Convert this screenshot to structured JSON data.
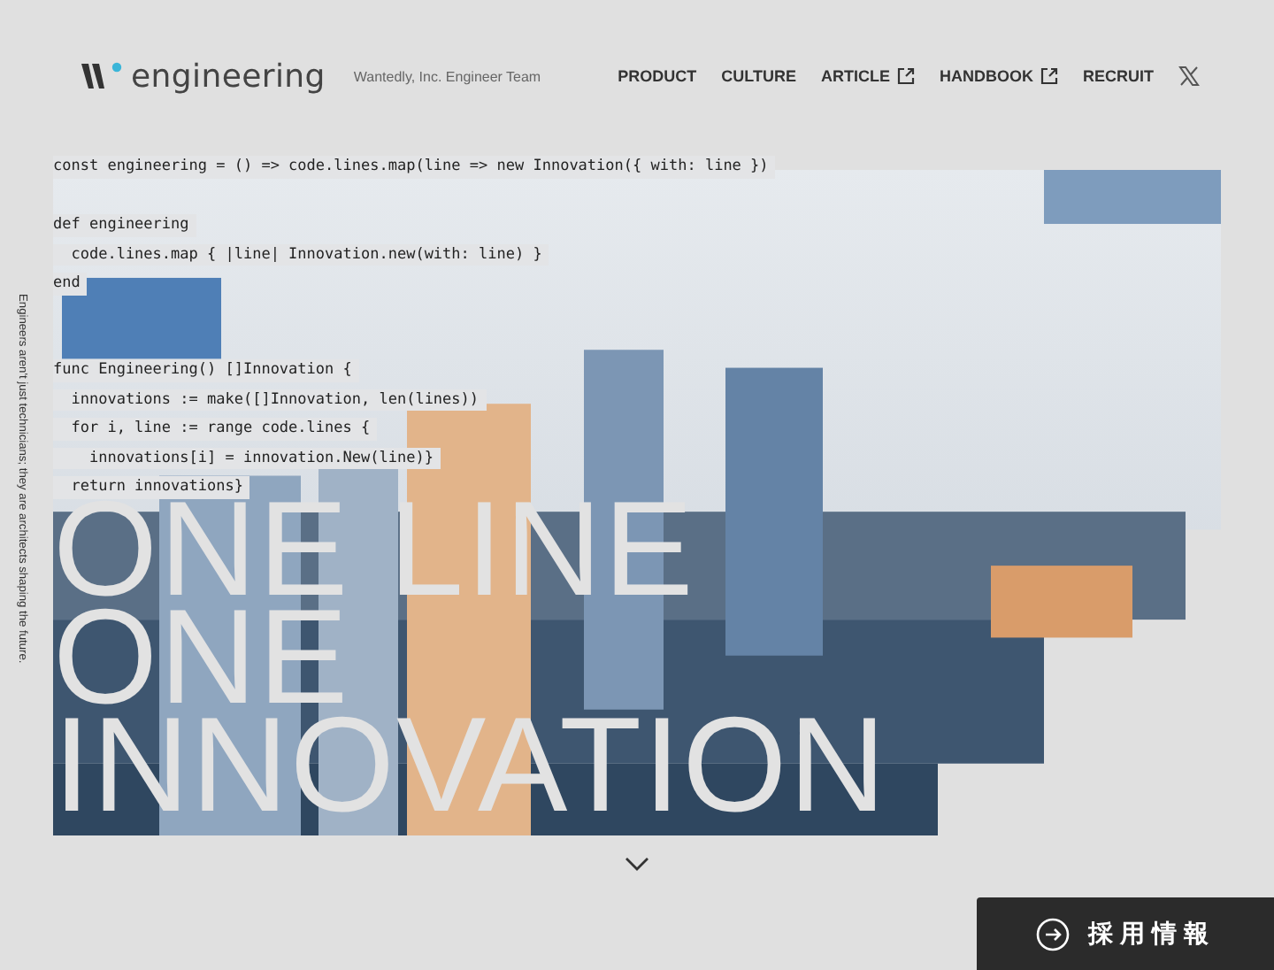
{
  "header": {
    "logo": "engineering",
    "tagline": "Wantedly, Inc. Engineer Team",
    "nav": [
      {
        "label": "PRODUCT",
        "external": false
      },
      {
        "label": "CULTURE",
        "external": false
      },
      {
        "label": "ARTICLE",
        "external": true
      },
      {
        "label": "HANDBOOK",
        "external": true
      },
      {
        "label": "RECRUIT",
        "external": false
      }
    ]
  },
  "code_blocks": [
    [
      "const engineering = () => code.lines.map(line => new Innovation({ with: line })"
    ],
    [
      "def engineering",
      "  code.lines.map { |line| Innovation.new(with: line) }",
      "end"
    ],
    [
      "func Engineering() []Innovation {",
      "  innovations := make([]Innovation, len(lines))",
      "  for i, line := range code.lines {",
      "    innovations[i] = innovation.New(line)}",
      "  return innovations}"
    ]
  ],
  "side_text": "Engineers aren't just technicians; they are architects shaping the future.",
  "headline": [
    "ONE LINE",
    "ONE",
    "INNOVATION"
  ],
  "recruit_button": "採用情報"
}
